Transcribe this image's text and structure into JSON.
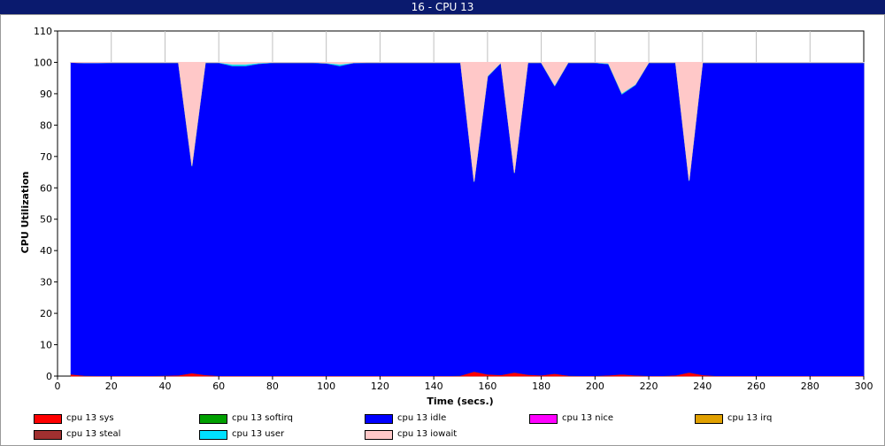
{
  "window": {
    "title": "16 - CPU 13"
  },
  "chart_data": {
    "type": "area",
    "stacked": true,
    "xlabel": "Time (secs.)",
    "ylabel": "CPU Utilization",
    "xlim": [
      0,
      300
    ],
    "ylim": [
      0,
      110
    ],
    "xticks": [
      0,
      20,
      40,
      60,
      80,
      100,
      120,
      140,
      160,
      180,
      200,
      220,
      240,
      260,
      280,
      300
    ],
    "yticks": [
      0,
      10,
      20,
      30,
      40,
      50,
      60,
      70,
      80,
      90,
      100,
      110
    ],
    "grid": "x",
    "x": [
      5,
      10,
      15,
      20,
      25,
      30,
      35,
      40,
      45,
      50,
      55,
      60,
      65,
      70,
      75,
      80,
      85,
      90,
      95,
      100,
      105,
      110,
      115,
      120,
      125,
      130,
      135,
      140,
      145,
      150,
      155,
      160,
      165,
      170,
      175,
      180,
      185,
      190,
      195,
      200,
      205,
      210,
      215,
      220,
      225,
      230,
      235,
      240,
      245,
      250,
      255,
      260,
      265,
      270,
      275,
      280,
      285,
      290,
      295,
      300
    ],
    "series": [
      {
        "name": "cpu 13 sys",
        "color": "#ff0000",
        "values": [
          0.6,
          0.2,
          0.1,
          0.1,
          0.1,
          0.1,
          0.1,
          0.2,
          0.3,
          1.0,
          0.4,
          0.1,
          0.1,
          0.1,
          0.1,
          0.1,
          0.1,
          0.1,
          0.1,
          0.1,
          0.1,
          0.1,
          0.1,
          0.1,
          0.1,
          0.1,
          0.1,
          0.1,
          0.1,
          0.2,
          1.5,
          0.6,
          0.4,
          1.2,
          0.5,
          0.3,
          0.8,
          0.2,
          0.1,
          0.1,
          0.3,
          0.6,
          0.3,
          0.1,
          0.1,
          0.3,
          1.2,
          0.4,
          0.1,
          0.1,
          0.1,
          0.1,
          0.1,
          0.1,
          0.1,
          0.1,
          0.1,
          0.1,
          0.1,
          0.1
        ]
      },
      {
        "name": "cpu 13 softirq",
        "color": "#00a000",
        "values": [
          0,
          0,
          0,
          0,
          0,
          0,
          0,
          0,
          0,
          0,
          0,
          0,
          0,
          0,
          0,
          0,
          0,
          0,
          0,
          0,
          0,
          0,
          0,
          0,
          0,
          0,
          0,
          0,
          0,
          0,
          0,
          0,
          0,
          0,
          0,
          0,
          0,
          0,
          0,
          0,
          0,
          0,
          0,
          0,
          0,
          0,
          0,
          0,
          0,
          0,
          0,
          0,
          0,
          0,
          0,
          0,
          0,
          0,
          0,
          0
        ]
      },
      {
        "name": "cpu 13 idle",
        "color": "#0000ff",
        "values": [
          99.4,
          99.6,
          99.7,
          99.8,
          99.8,
          99.8,
          99.8,
          99.7,
          99.6,
          66.0,
          99.5,
          99.8,
          98.8,
          98.8,
          99.5,
          99.8,
          99.8,
          99.8,
          99.8,
          99.6,
          98.8,
          99.7,
          99.8,
          99.8,
          99.8,
          99.8,
          99.8,
          99.8,
          99.8,
          99.7,
          60.5,
          94.9,
          99.5,
          63.6,
          99.4,
          99.6,
          91.7,
          99.7,
          99.8,
          99.8,
          99.2,
          89.3,
          92.5,
          99.8,
          99.8,
          99.6,
          61.1,
          99.5,
          99.8,
          99.8,
          99.8,
          99.8,
          99.8,
          99.8,
          99.8,
          99.8,
          99.8,
          99.8,
          99.8,
          99.8
        ]
      },
      {
        "name": "cpu 13 nice",
        "color": "#ff00ff",
        "values": [
          0,
          0,
          0,
          0,
          0,
          0,
          0,
          0,
          0,
          0,
          0,
          0,
          0,
          0,
          0,
          0,
          0,
          0,
          0,
          0,
          0,
          0,
          0,
          0,
          0,
          0,
          0,
          0,
          0,
          0,
          0,
          0,
          0,
          0,
          0,
          0,
          0,
          0,
          0,
          0,
          0,
          0,
          0,
          0,
          0,
          0,
          0,
          0,
          0,
          0,
          0,
          0,
          0,
          0,
          0,
          0,
          0,
          0,
          0,
          0
        ]
      },
      {
        "name": "cpu 13 irq",
        "color": "#e0a000",
        "values": [
          0,
          0,
          0,
          0,
          0,
          0,
          0,
          0,
          0,
          0,
          0,
          0,
          0,
          0,
          0,
          0,
          0,
          0,
          0,
          0,
          0,
          0,
          0,
          0,
          0,
          0,
          0,
          0,
          0,
          0,
          0,
          0,
          0,
          0,
          0,
          0,
          0,
          0,
          0,
          0,
          0,
          0,
          0,
          0,
          0,
          0,
          0,
          0,
          0,
          0,
          0,
          0,
          0,
          0,
          0,
          0,
          0,
          0,
          0,
          0
        ]
      },
      {
        "name": "cpu 13 steal",
        "color": "#a03030",
        "values": [
          0,
          0,
          0,
          0,
          0,
          0,
          0,
          0,
          0,
          0,
          0,
          0,
          0,
          0,
          0,
          0,
          0,
          0,
          0,
          0,
          0,
          0,
          0,
          0,
          0,
          0,
          0,
          0,
          0,
          0,
          0,
          0,
          0,
          0,
          0,
          0,
          0,
          0,
          0,
          0,
          0,
          0,
          0,
          0,
          0,
          0,
          0,
          0,
          0,
          0,
          0,
          0,
          0,
          0,
          0,
          0,
          0,
          0,
          0,
          0
        ]
      },
      {
        "name": "cpu 13 user",
        "color": "#00e0ff",
        "values": [
          0,
          0.1,
          0.1,
          0.1,
          0.1,
          0.1,
          0.1,
          0.1,
          0.1,
          0.2,
          0.1,
          0.1,
          0.5,
          0.5,
          0.2,
          0.1,
          0.1,
          0.1,
          0.1,
          0.1,
          0.5,
          0.1,
          0.1,
          0.1,
          0.1,
          0.1,
          0.1,
          0.1,
          0.1,
          0.1,
          0.2,
          0.2,
          0.1,
          0.2,
          0.1,
          0.1,
          0.2,
          0.1,
          0.1,
          0.1,
          0.2,
          0.3,
          0.2,
          0.1,
          0.1,
          0.1,
          0.2,
          0.1,
          0.1,
          0.1,
          0.1,
          0.1,
          0.1,
          0.1,
          0.1,
          0.1,
          0.1,
          0.1,
          0.1,
          0.1
        ]
      },
      {
        "name": "cpu 13 iowait",
        "color": "#ffc8c8",
        "values": [
          0,
          0.1,
          0.1,
          0,
          0,
          0,
          0,
          0,
          0,
          32.8,
          0,
          0,
          0.6,
          0.6,
          0.2,
          0,
          0,
          0,
          0,
          0.2,
          0.6,
          0.1,
          0,
          0,
          0,
          0,
          0,
          0,
          0,
          0,
          37.8,
          4.3,
          0,
          35.0,
          0,
          0,
          7.3,
          0,
          0,
          0,
          0.3,
          9.8,
          7.0,
          0,
          0,
          0,
          37.5,
          0,
          0,
          0,
          0,
          0,
          0,
          0,
          0,
          0,
          0,
          0,
          0,
          0
        ]
      }
    ]
  }
}
